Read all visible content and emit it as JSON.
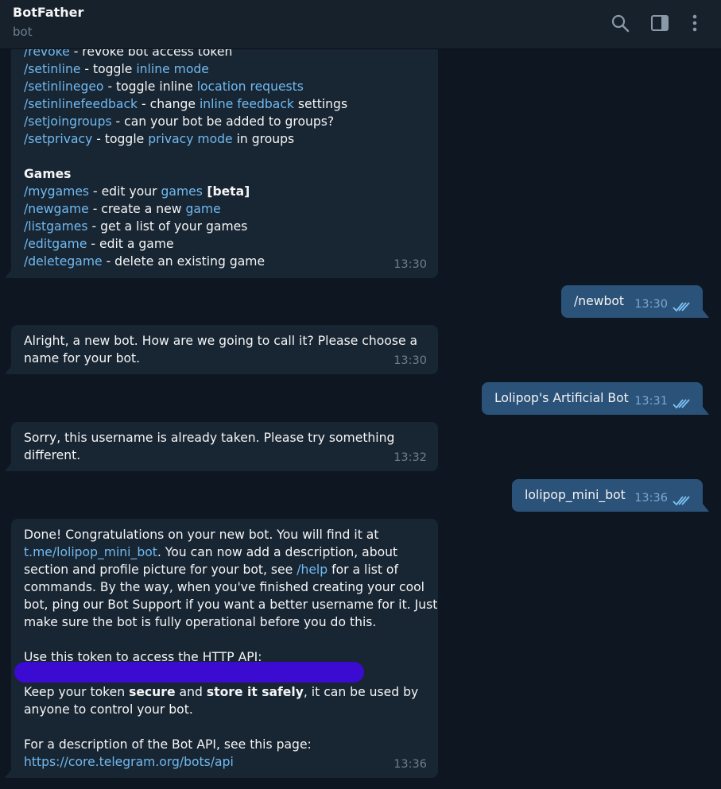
{
  "header": {
    "title": "BotFather",
    "subtitle": "bot",
    "icons": [
      "search-icon",
      "sidebar-toggle-icon",
      "more-vertical-icon"
    ]
  },
  "colors": {
    "background": "#0e1621",
    "incoming": "#182533",
    "outgoing": "#2b5278",
    "link": "#71baf0",
    "timestamp": "#6d7f8f",
    "redaction": "#3b0bd2"
  },
  "msg1": {
    "l1": {
      "cmd": "/revoke",
      "text": " - revoke bot access token"
    },
    "l2": {
      "cmd": "/setinline",
      "t1": " - toggle ",
      "link": "inline mode"
    },
    "l3": {
      "cmd": "/setinlinegeo",
      "t1": " - toggle inline ",
      "link": "location requests"
    },
    "l4": {
      "cmd": "/setinlinefeedback",
      "t1": " - change ",
      "link": "inline feedback",
      "t2": " settings"
    },
    "l5": {
      "cmd": "/setjoingroups",
      "text": " - can your bot be added to groups?"
    },
    "l6": {
      "cmd": "/setprivacy",
      "t1": " - toggle ",
      "link": "privacy mode",
      "t2": " in groups"
    },
    "heading": "Games",
    "l7": {
      "cmd": "/mygames",
      "t1": " - edit your ",
      "link": "games",
      "bold": " [beta]"
    },
    "l8": {
      "cmd": "/newgame",
      "t1": " - create a new ",
      "link": "game"
    },
    "l9": {
      "cmd": "/listgames",
      "text": " - get a list of your games"
    },
    "l10": {
      "cmd": "/editgame",
      "text": " - edit a game"
    },
    "l11": {
      "cmd": "/deletegame",
      "text": " - delete an existing game"
    },
    "time": "13:30"
  },
  "msg2": {
    "text": "/newbot",
    "time": "13:30"
  },
  "msg3": {
    "l1": "Alright, a new bot. How are we going to call it? Please choose a",
    "l2": "name for your bot.",
    "time": "13:30"
  },
  "msg4": {
    "text": "Lolipop's Artificial Bot",
    "time": "13:31"
  },
  "msg5": {
    "l1": "Sorry, this username is already taken. Please try something",
    "l2": "different.",
    "time": "13:32"
  },
  "msg6": {
    "text": "lolipop_mini_bot",
    "time": "13:36"
  },
  "msg7": {
    "l1": "Done! Congratulations on your new bot. You will find it at",
    "l2_link": "t.me/lolipop_mini_bot",
    "l2_text": ". You can now add a description, about",
    "l3_a": "section and profile picture for your bot, see ",
    "l3_link": "/help",
    "l3_b": " for a list of",
    "l4": "commands. By the way, when you've finished creating your cool",
    "l5": "bot, ping our Bot Support if you want a better username for it. Just",
    "l6": "make sure the bot is fully operational before you do this.",
    "l7": "Use this token to access the HTTP API:",
    "l8_a": "Keep your token ",
    "l8_b1": "secure",
    "l8_c": " and ",
    "l8_b2": "store it safely",
    "l8_d": ", it can be used by",
    "l9": "anyone to control your bot.",
    "l10": "For a description of the Bot API, see this page:",
    "l11_link": "https://core.telegram.org/bots/api",
    "time": "13:36"
  }
}
